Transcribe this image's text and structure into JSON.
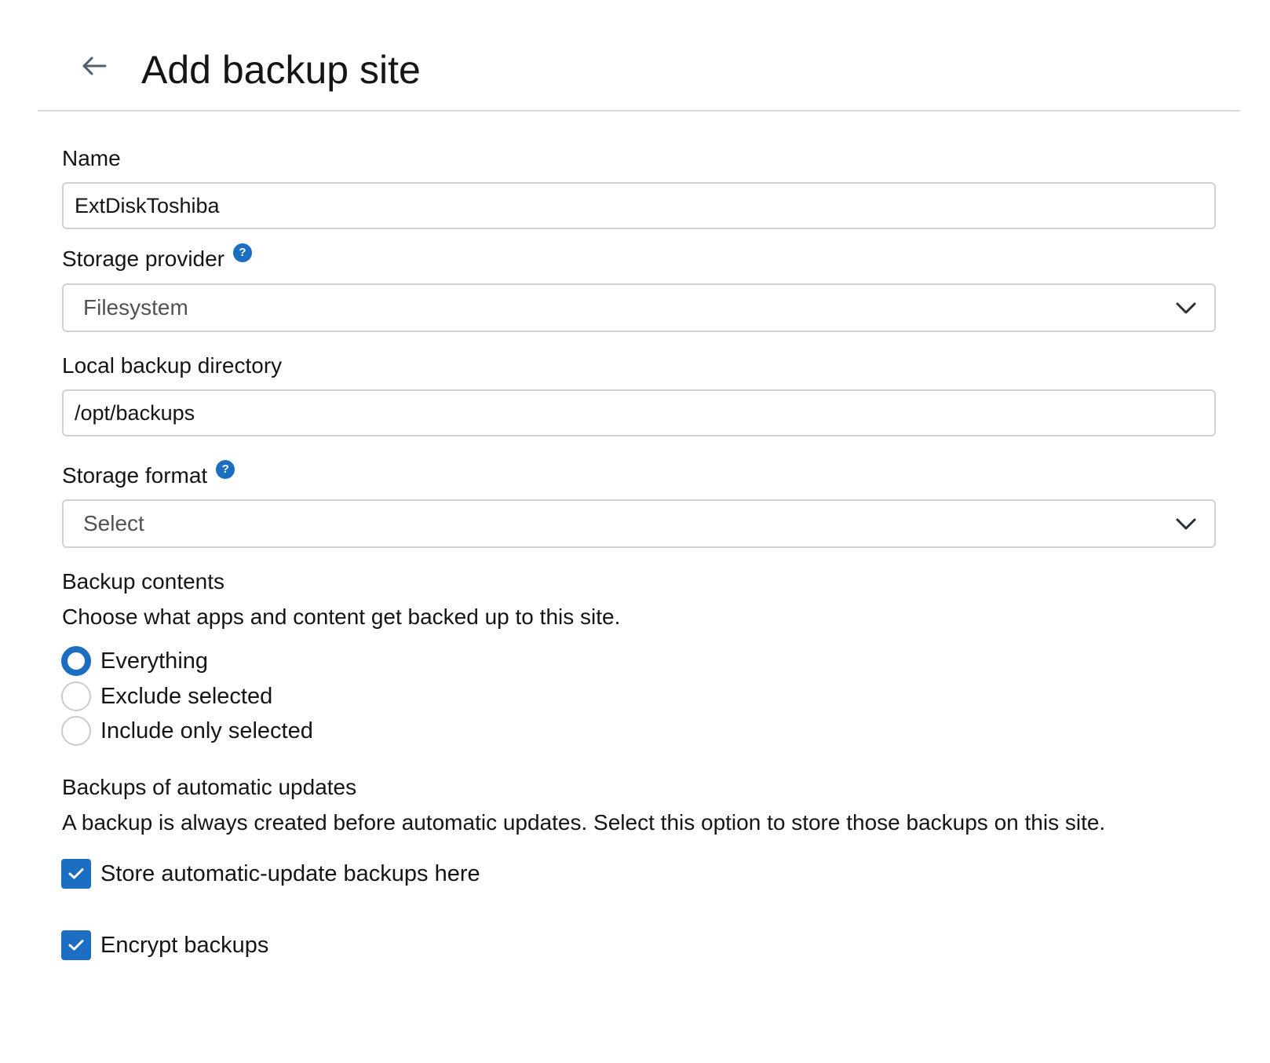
{
  "header": {
    "title": "Add backup site",
    "back_icon": "arrow-left-icon"
  },
  "form": {
    "name": {
      "label": "Name",
      "value": "ExtDiskToshiba"
    },
    "storage_provider": {
      "label": "Storage provider",
      "help": "?",
      "selected": "Filesystem"
    },
    "local_backup_directory": {
      "label": "Local backup directory",
      "value": "/opt/backups"
    },
    "storage_format": {
      "label": "Storage format",
      "help": "?",
      "selected": "Select"
    },
    "backup_contents": {
      "title": "Backup contents",
      "description": "Choose what apps and content get backed up to this site.",
      "options": [
        {
          "label": "Everything",
          "checked": true
        },
        {
          "label": "Exclude selected",
          "checked": false
        },
        {
          "label": "Include only selected",
          "checked": false
        }
      ]
    },
    "automatic_updates": {
      "title": "Backups of automatic updates",
      "description": "A backup is always created before automatic updates. Select this option to store those backups on this site.",
      "checkbox_label": "Store automatic-update backups here",
      "checked": true
    },
    "encrypt": {
      "checkbox_label": "Encrypt backups",
      "checked": true
    }
  },
  "colors": {
    "accent": "#1b6ec2",
    "border": "#d2d2d2",
    "divider": "#d9dde3",
    "text": "#151515"
  }
}
